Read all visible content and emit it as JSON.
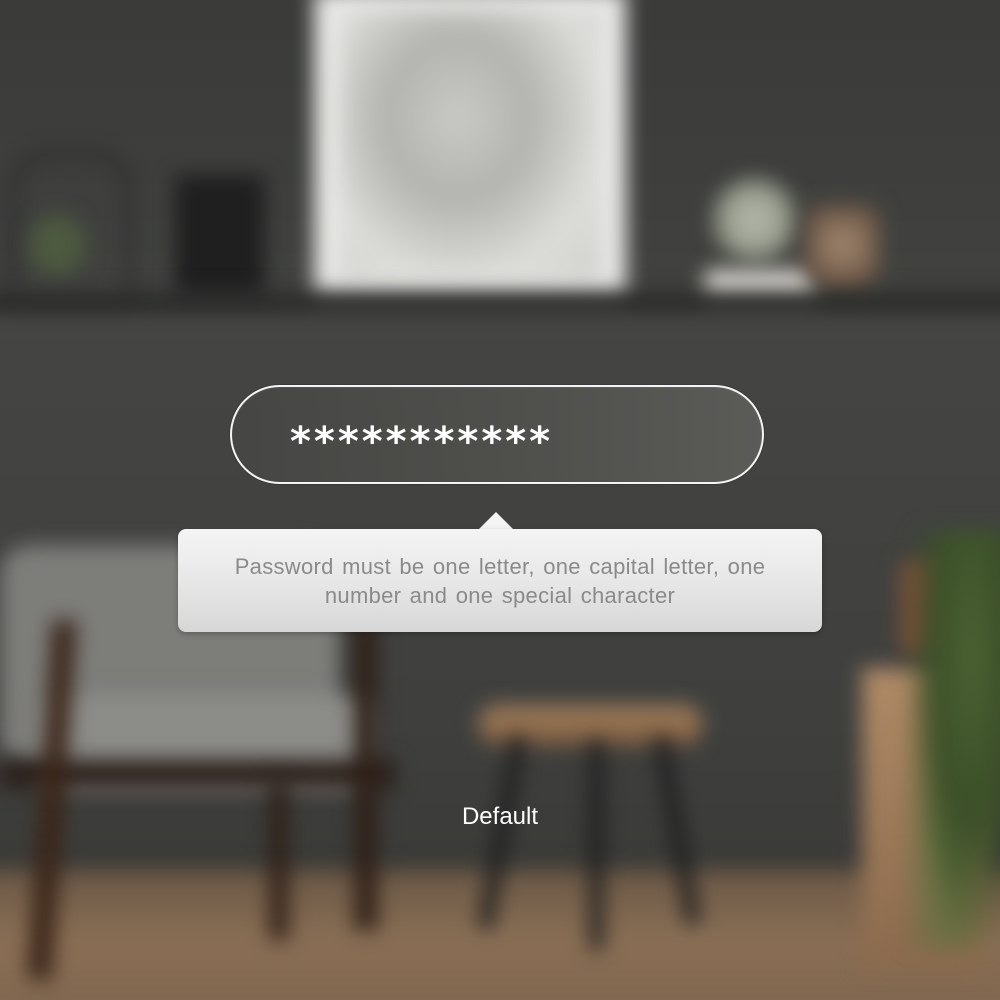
{
  "password_field": {
    "masked_value": "***********"
  },
  "tooltip": {
    "message": "Password must be one letter, one capital letter, one number and one special character"
  },
  "state_label": "Default",
  "colors": {
    "field_border": "#f4f4f4",
    "field_text": "#ffffff",
    "tooltip_background": "#e6e6e6",
    "tooltip_text": "#8a8a8a"
  }
}
